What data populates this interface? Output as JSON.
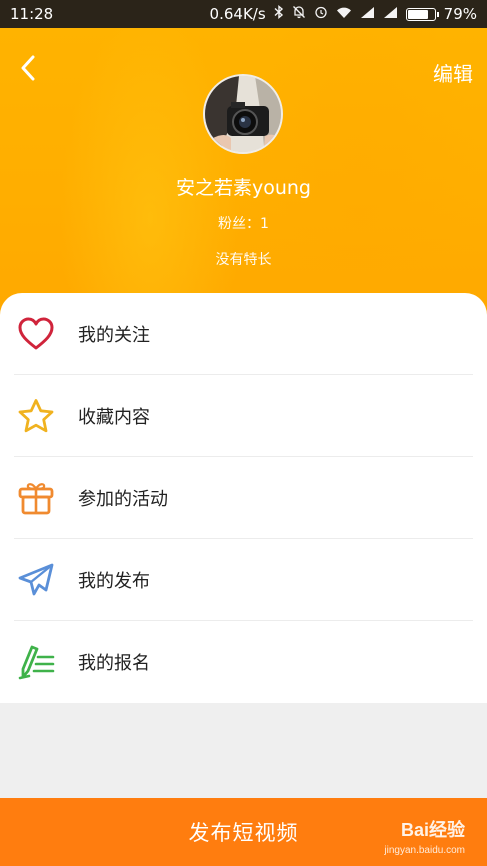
{
  "status_bar": {
    "time": "11:28",
    "network_speed": "0.64K/s",
    "battery_percent": "79%",
    "battery_level": 0.79,
    "icons": [
      "bluetooth-icon",
      "notifications-off-icon",
      "alarm-icon",
      "wifi-icon",
      "signal-icon",
      "signal-icon-2"
    ]
  },
  "header": {
    "edit_label": "编辑",
    "back_icon": "chevron-left-icon"
  },
  "profile": {
    "name": "安之若素young",
    "fans": "粉丝：1",
    "specialty": "没有特长"
  },
  "menu": {
    "items": [
      {
        "label": "我的关注",
        "icon": "heart-icon",
        "color": "#d0243b"
      },
      {
        "label": "收藏内容",
        "icon": "star-icon",
        "color": "#f0b21f"
      },
      {
        "label": "参加的活动",
        "icon": "gift-icon",
        "color": "#f08a2f"
      },
      {
        "label": "我的发布",
        "icon": "paper-plane-icon",
        "color": "#5a8fd8"
      },
      {
        "label": "我的报名",
        "icon": "signup-pen-icon",
        "color": "#3fb24a"
      }
    ]
  },
  "bottom_bar": {
    "publish_label": "发布短视频"
  },
  "watermark": {
    "text": "Bai经验",
    "sub": "jingyan.baidu.com"
  },
  "colors": {
    "header": "#ffb000",
    "bottom_bar": "#ff7d0f"
  }
}
